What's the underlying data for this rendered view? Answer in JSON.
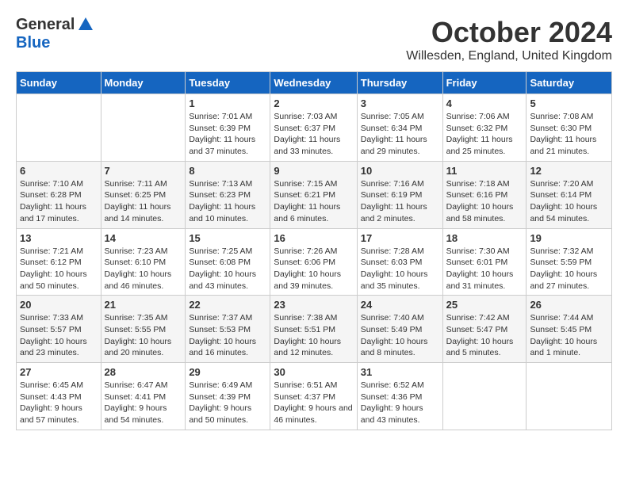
{
  "header": {
    "logo_general": "General",
    "logo_blue": "Blue",
    "month_title": "October 2024",
    "location": "Willesden, England, United Kingdom"
  },
  "days_of_week": [
    "Sunday",
    "Monday",
    "Tuesday",
    "Wednesday",
    "Thursday",
    "Friday",
    "Saturday"
  ],
  "weeks": [
    [
      {
        "day": "",
        "content": ""
      },
      {
        "day": "",
        "content": ""
      },
      {
        "day": "1",
        "content": "Sunrise: 7:01 AM\nSunset: 6:39 PM\nDaylight: 11 hours and 37 minutes."
      },
      {
        "day": "2",
        "content": "Sunrise: 7:03 AM\nSunset: 6:37 PM\nDaylight: 11 hours and 33 minutes."
      },
      {
        "day": "3",
        "content": "Sunrise: 7:05 AM\nSunset: 6:34 PM\nDaylight: 11 hours and 29 minutes."
      },
      {
        "day": "4",
        "content": "Sunrise: 7:06 AM\nSunset: 6:32 PM\nDaylight: 11 hours and 25 minutes."
      },
      {
        "day": "5",
        "content": "Sunrise: 7:08 AM\nSunset: 6:30 PM\nDaylight: 11 hours and 21 minutes."
      }
    ],
    [
      {
        "day": "6",
        "content": "Sunrise: 7:10 AM\nSunset: 6:28 PM\nDaylight: 11 hours and 17 minutes."
      },
      {
        "day": "7",
        "content": "Sunrise: 7:11 AM\nSunset: 6:25 PM\nDaylight: 11 hours and 14 minutes."
      },
      {
        "day": "8",
        "content": "Sunrise: 7:13 AM\nSunset: 6:23 PM\nDaylight: 11 hours and 10 minutes."
      },
      {
        "day": "9",
        "content": "Sunrise: 7:15 AM\nSunset: 6:21 PM\nDaylight: 11 hours and 6 minutes."
      },
      {
        "day": "10",
        "content": "Sunrise: 7:16 AM\nSunset: 6:19 PM\nDaylight: 11 hours and 2 minutes."
      },
      {
        "day": "11",
        "content": "Sunrise: 7:18 AM\nSunset: 6:16 PM\nDaylight: 10 hours and 58 minutes."
      },
      {
        "day": "12",
        "content": "Sunrise: 7:20 AM\nSunset: 6:14 PM\nDaylight: 10 hours and 54 minutes."
      }
    ],
    [
      {
        "day": "13",
        "content": "Sunrise: 7:21 AM\nSunset: 6:12 PM\nDaylight: 10 hours and 50 minutes."
      },
      {
        "day": "14",
        "content": "Sunrise: 7:23 AM\nSunset: 6:10 PM\nDaylight: 10 hours and 46 minutes."
      },
      {
        "day": "15",
        "content": "Sunrise: 7:25 AM\nSunset: 6:08 PM\nDaylight: 10 hours and 43 minutes."
      },
      {
        "day": "16",
        "content": "Sunrise: 7:26 AM\nSunset: 6:06 PM\nDaylight: 10 hours and 39 minutes."
      },
      {
        "day": "17",
        "content": "Sunrise: 7:28 AM\nSunset: 6:03 PM\nDaylight: 10 hours and 35 minutes."
      },
      {
        "day": "18",
        "content": "Sunrise: 7:30 AM\nSunset: 6:01 PM\nDaylight: 10 hours and 31 minutes."
      },
      {
        "day": "19",
        "content": "Sunrise: 7:32 AM\nSunset: 5:59 PM\nDaylight: 10 hours and 27 minutes."
      }
    ],
    [
      {
        "day": "20",
        "content": "Sunrise: 7:33 AM\nSunset: 5:57 PM\nDaylight: 10 hours and 23 minutes."
      },
      {
        "day": "21",
        "content": "Sunrise: 7:35 AM\nSunset: 5:55 PM\nDaylight: 10 hours and 20 minutes."
      },
      {
        "day": "22",
        "content": "Sunrise: 7:37 AM\nSunset: 5:53 PM\nDaylight: 10 hours and 16 minutes."
      },
      {
        "day": "23",
        "content": "Sunrise: 7:38 AM\nSunset: 5:51 PM\nDaylight: 10 hours and 12 minutes."
      },
      {
        "day": "24",
        "content": "Sunrise: 7:40 AM\nSunset: 5:49 PM\nDaylight: 10 hours and 8 minutes."
      },
      {
        "day": "25",
        "content": "Sunrise: 7:42 AM\nSunset: 5:47 PM\nDaylight: 10 hours and 5 minutes."
      },
      {
        "day": "26",
        "content": "Sunrise: 7:44 AM\nSunset: 5:45 PM\nDaylight: 10 hours and 1 minute."
      }
    ],
    [
      {
        "day": "27",
        "content": "Sunrise: 6:45 AM\nSunset: 4:43 PM\nDaylight: 9 hours and 57 minutes."
      },
      {
        "day": "28",
        "content": "Sunrise: 6:47 AM\nSunset: 4:41 PM\nDaylight: 9 hours and 54 minutes."
      },
      {
        "day": "29",
        "content": "Sunrise: 6:49 AM\nSunset: 4:39 PM\nDaylight: 9 hours and 50 minutes."
      },
      {
        "day": "30",
        "content": "Sunrise: 6:51 AM\nSunset: 4:37 PM\nDaylight: 9 hours and 46 minutes."
      },
      {
        "day": "31",
        "content": "Sunrise: 6:52 AM\nSunset: 4:36 PM\nDaylight: 9 hours and 43 minutes."
      },
      {
        "day": "",
        "content": ""
      },
      {
        "day": "",
        "content": ""
      }
    ]
  ]
}
